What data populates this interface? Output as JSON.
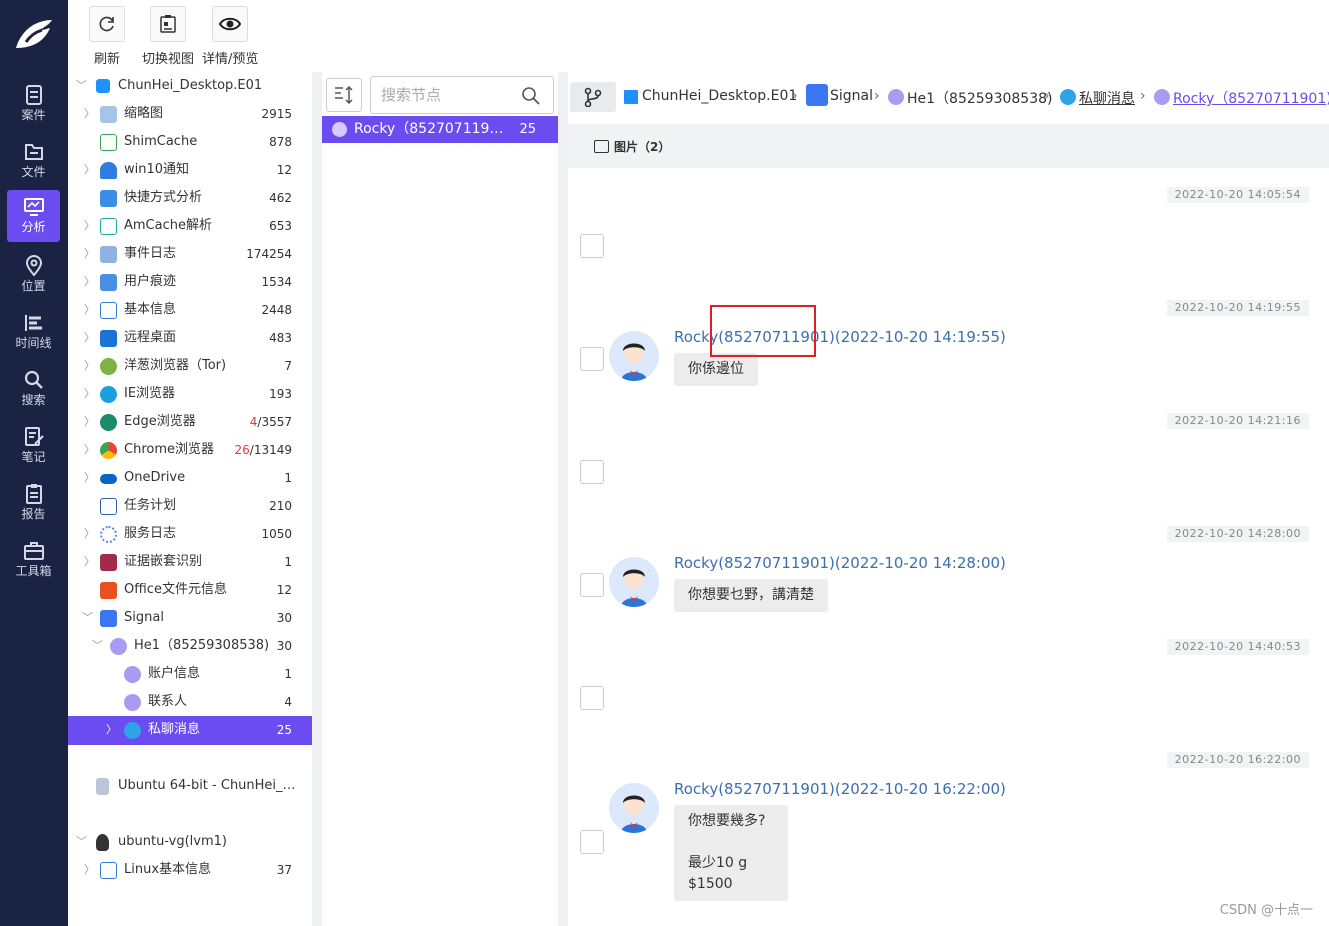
{
  "nav": {
    "items": [
      {
        "label": "案件"
      },
      {
        "label": "文件"
      },
      {
        "label": "分析"
      },
      {
        "label": "位置"
      },
      {
        "label": "时间线"
      },
      {
        "label": "搜索"
      },
      {
        "label": "笔记"
      },
      {
        "label": "报告"
      },
      {
        "label": "工具箱"
      }
    ],
    "active": "分析"
  },
  "toolbar": {
    "refresh": "刷新",
    "switch_view": "切换视图",
    "detail_preview": "详情/预览"
  },
  "tree": {
    "root": "ChunHei_Desktop.E01",
    "items": [
      {
        "label": "缩略图",
        "count": "2915"
      },
      {
        "label": "ShimCache",
        "count": "878"
      },
      {
        "label": "win10通知",
        "count": "12"
      },
      {
        "label": "快捷方式分析",
        "count": "462"
      },
      {
        "label": "AmCache解析",
        "count": "653"
      },
      {
        "label": "事件日志",
        "count": "174254"
      },
      {
        "label": "用户痕迹",
        "count": "1534"
      },
      {
        "label": "基本信息",
        "count": "2448"
      },
      {
        "label": "远程桌面",
        "count": "483"
      },
      {
        "label": "洋葱浏览器（Tor)",
        "count": "7"
      },
      {
        "label": "IE浏览器",
        "count": "193"
      },
      {
        "label": "Edge浏览器",
        "count_red": "4",
        "count": "/3557"
      },
      {
        "label": "Chrome浏览器",
        "count_red": "26",
        "count": "/13149"
      },
      {
        "label": "OneDrive",
        "count": "1"
      },
      {
        "label": "任务计划",
        "count": "210"
      },
      {
        "label": "服务日志",
        "count": "1050"
      },
      {
        "label": "证据嵌套识别",
        "count": "1"
      },
      {
        "label": "Office文件元信息",
        "count": "12"
      },
      {
        "label": "Signal",
        "count": "30"
      },
      {
        "label": "He1（85259308538)",
        "count": "30"
      },
      {
        "label": "账户信息",
        "count": "1"
      },
      {
        "label": "联系人",
        "count": "4"
      },
      {
        "label": "私聊消息",
        "count": "25"
      }
    ],
    "ubuntu": "Ubuntu 64-bit - ChunHei_De...",
    "lvm": "ubuntu-vg(lvm1)",
    "linux": {
      "label": "Linux基本信息",
      "count": "37"
    }
  },
  "mid": {
    "search_placeholder": "搜索节点",
    "contact": {
      "name": "Rocky（8527071190...",
      "count": "25"
    }
  },
  "breadcrumb": {
    "evidence": "ChunHei_Desktop.E01",
    "app": "Signal",
    "account": "He1（85259308538)",
    "category": "私聊消息",
    "contact": "Rocky（85270711901)"
  },
  "tab": {
    "label": "图片（2）"
  },
  "messages": [
    {
      "time": "2022-10-20 14:05:54"
    },
    {
      "time": "2022-10-20 14:19:55",
      "sender": "Rocky(85270711901)(2022-10-20 14:19:55)",
      "lines": [
        "你係邊位"
      ]
    },
    {
      "time": "2022-10-20 14:21:16"
    },
    {
      "time": "2022-10-20 14:28:00",
      "sender": "Rocky(85270711901)(2022-10-20 14:28:00)",
      "lines": [
        "你想要乜野，講清楚"
      ]
    },
    {
      "time": "2022-10-20 14:40:53"
    },
    {
      "time": "2022-10-20 16:22:00",
      "sender": "Rocky(85270711901)(2022-10-20 16:22:00)",
      "lines": [
        "你想要幾多?",
        "",
        "最少10 g",
        "$1500"
      ]
    }
  ],
  "watermark": "CSDN @十点一",
  "colors": {
    "nav_bg": "#1a2343",
    "accent": "#6a4cf0",
    "sender": "#3a6fb0",
    "highlight": "#e02020"
  }
}
